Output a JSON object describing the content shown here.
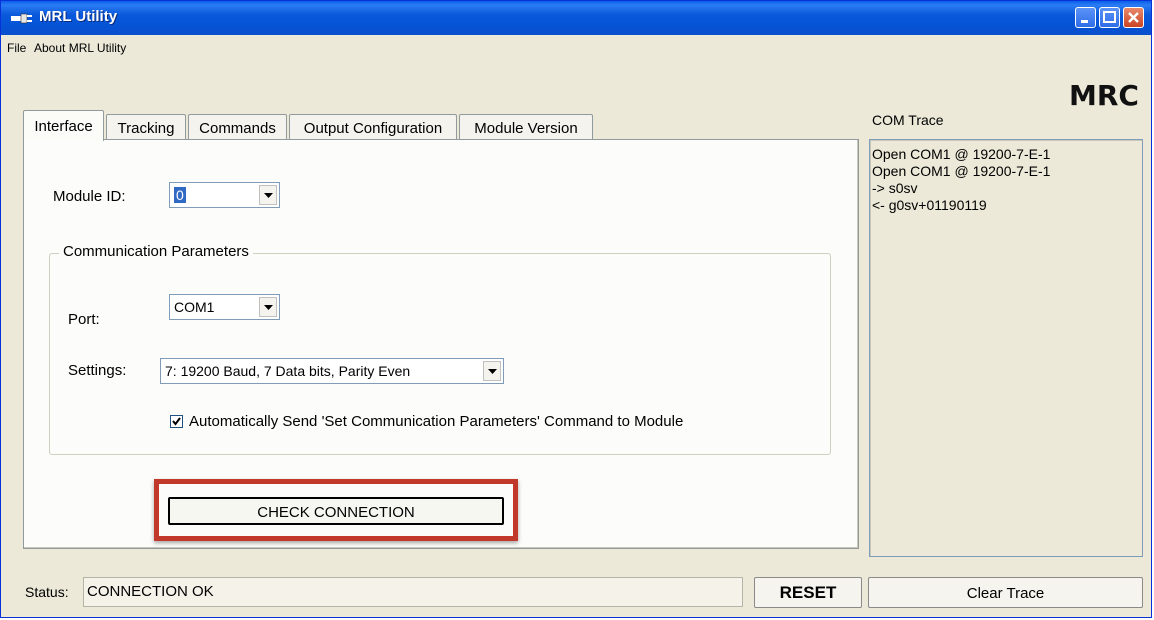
{
  "window": {
    "title": "MRL Utility"
  },
  "menu": {
    "file": "File",
    "about": "About MRL Utility"
  },
  "logo": "MRC",
  "tabs": [
    "Interface",
    "Tracking",
    "Commands",
    "Output Configuration",
    "Module Version"
  ],
  "interface": {
    "module_id_label": "Module ID:",
    "module_id_value": "0",
    "group_title": "Communication Parameters",
    "port_label": "Port:",
    "port_value": "COM1",
    "settings_label": "Settings:",
    "settings_value": "7: 19200 Baud, 7 Data bits, Parity Even",
    "auto_send_label": "Automatically Send 'Set Communication Parameters' Command  to Module",
    "auto_send_checked": true,
    "check_button": "CHECK CONNECTION"
  },
  "status": {
    "label": "Status:",
    "value": "CONNECTION OK",
    "reset_button": "RESET"
  },
  "trace": {
    "title": "COM Trace",
    "lines": [
      "Open COM1 @ 19200-7-E-1",
      "Open COM1 @ 19200-7-E-1",
      "-> s0sv",
      "<- g0sv+01190119"
    ],
    "clear_button": "Clear Trace"
  },
  "colors": {
    "titlebar": "#0553d6",
    "highlight": "#c0392b",
    "selection": "#316ac5"
  }
}
